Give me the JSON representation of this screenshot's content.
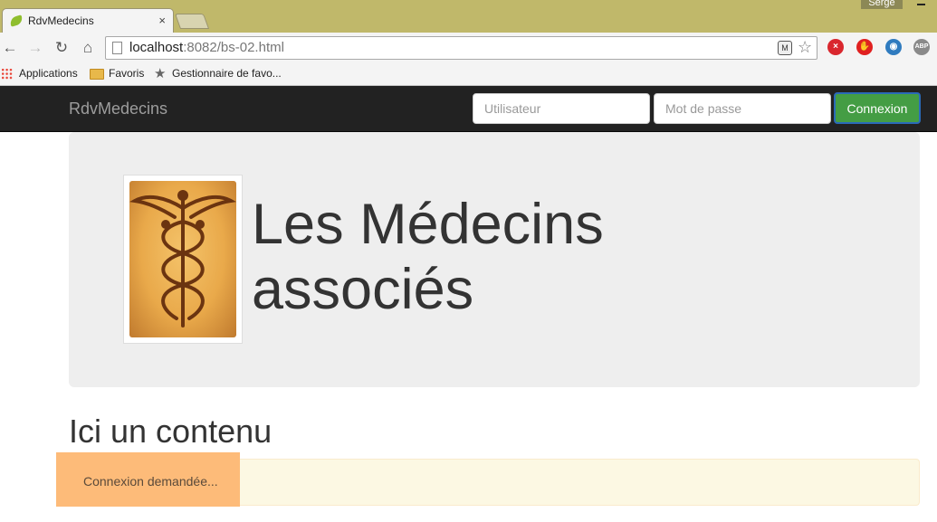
{
  "browser": {
    "tab_title": "RdvMedecins",
    "tab_close": "×",
    "profile_name": "Serge",
    "url_host": "localhost",
    "url_rest": ":8082/bs-02.html",
    "bookmarks": [
      {
        "label": "Applications",
        "icon": "apps-grid-icon"
      },
      {
        "label": "Favoris",
        "icon": "folder-icon"
      },
      {
        "label": "Gestionnaire de favo...",
        "icon": "star-icon"
      }
    ],
    "extensions": [
      "close-x-icon",
      "stop-hand-icon",
      "globe-icon",
      "adblock-icon"
    ],
    "extension_labels": {
      "adblock": "ABP"
    }
  },
  "navbar": {
    "brand": "RdvMedecins",
    "username_placeholder": "Utilisateur",
    "password_placeholder": "Mot de passe",
    "login_button": "Connexion",
    "background": "#222222",
    "button_color": "#449d44"
  },
  "jumbotron": {
    "image_icon": "caduceus-icon",
    "title": "Les Médecins associés"
  },
  "content": {
    "heading": "Ici un contenu",
    "status_message": "Connexion demandée..."
  }
}
